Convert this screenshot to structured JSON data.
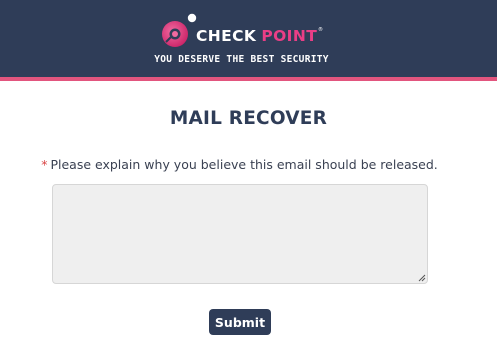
{
  "header": {
    "brand_word_1": "CHECK",
    "brand_word_2": "POINT",
    "trademark": "®",
    "tagline": "YOU DESERVE THE BEST SECURITY",
    "background_color": "#2f3d58",
    "stripe_color": "#e2557e",
    "logo_icon": "check-point-logo-icon"
  },
  "main": {
    "title": "MAIL RECOVER",
    "required_marker": "*",
    "prompt": "Please explain why you believe this email should be released.",
    "reason_value": "",
    "submit_label": "Submit"
  }
}
